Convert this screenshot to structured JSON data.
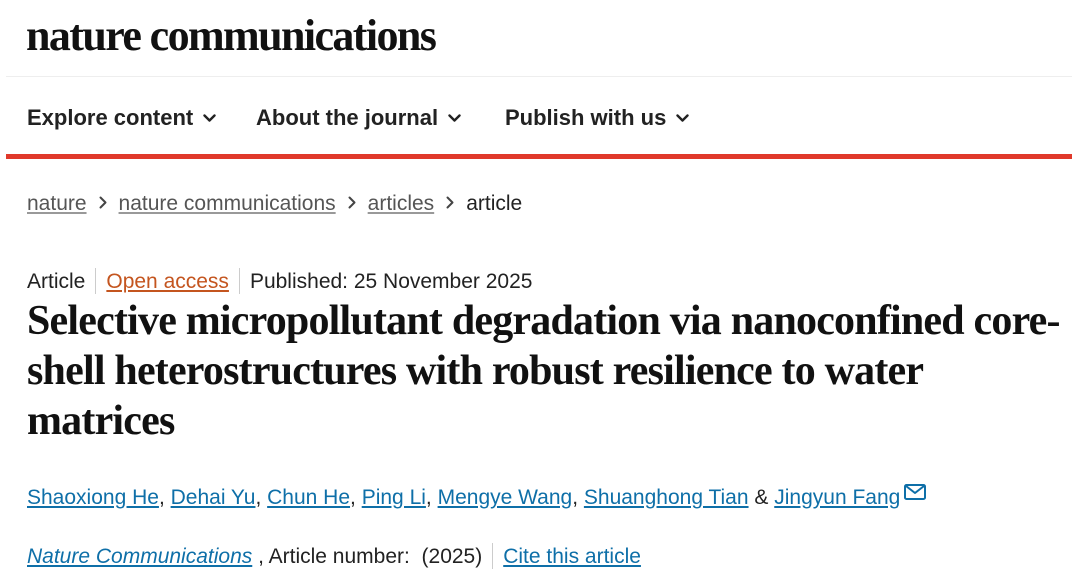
{
  "site": {
    "logo": "nature communications"
  },
  "nav": {
    "items": [
      {
        "label": "Explore content",
        "icon": "chevron-down-icon"
      },
      {
        "label": "About the journal",
        "icon": "chevron-down-icon"
      },
      {
        "label": "Publish with us",
        "icon": "chevron-down-icon"
      }
    ]
  },
  "breadcrumb": {
    "items": [
      {
        "label": "nature"
      },
      {
        "label": "nature communications"
      },
      {
        "label": "articles"
      }
    ],
    "current": "article",
    "separator_icon": "chevron-right-icon"
  },
  "article": {
    "type": "Article",
    "access": "Open access",
    "published": "Published: 25 November 2025",
    "title": "Selective micropollutant degradation via nanoconfined core-shell heterostructures with robust resilience to water matrices",
    "authors": [
      "Shaoxiong He",
      "Dehai Yu",
      "Chun He",
      "Ping Li",
      "Mengye Wang",
      "Shuanghong Tian",
      "Jingyun Fang"
    ],
    "author_separator": ", ",
    "last_author_joiner": " & ",
    "contact_icon": "mail-icon",
    "citation": {
      "journal": "Nature Communications",
      "article_number": ", Article number:",
      "year": "(2025)",
      "cite_label": "Cite this article"
    }
  },
  "colors": {
    "accent_rule": "#e0392b",
    "link": "#0e6fa8",
    "open_access": "#c4551f",
    "text": "#222222"
  }
}
